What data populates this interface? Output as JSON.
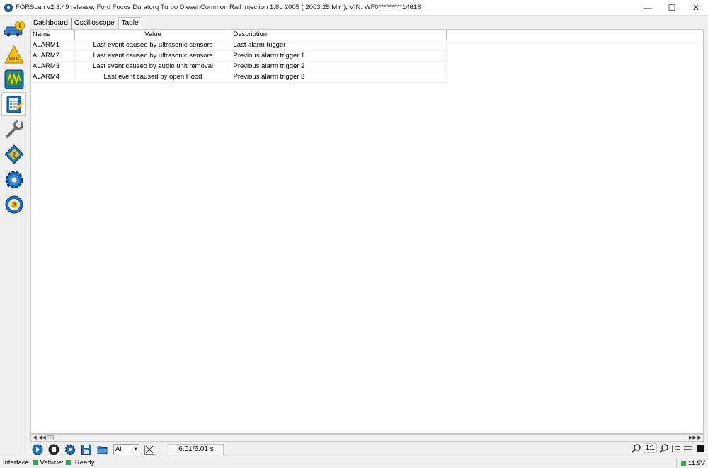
{
  "window": {
    "title": "FORScan v2.3.49 release, Ford Focus Duratorq Turbo Diesel Common Rail Injection 1.8L 2005 ( 2003.25 MY ), VIN: WF0*********14618",
    "minimize": "—",
    "maximize": "☐",
    "close": "✕"
  },
  "sidebar": {
    "items": [
      {
        "icon": "vehicle-info-icon"
      },
      {
        "icon": "dtc-icon"
      },
      {
        "icon": "oscilloscope-icon"
      },
      {
        "icon": "tests-checklist-icon"
      },
      {
        "icon": "service-wrench-icon"
      },
      {
        "icon": "configuration-chip-icon"
      },
      {
        "icon": "settings-gear-icon"
      },
      {
        "icon": "help-steering-icon"
      }
    ]
  },
  "tabs": [
    {
      "label": "Dashboard"
    },
    {
      "label": "Oscilloscope"
    },
    {
      "label": "Table"
    }
  ],
  "table": {
    "headers": {
      "name": "Name",
      "value": "Value",
      "description": "Description"
    },
    "rows": [
      {
        "name": "ALARM1",
        "value": "Last event caused by ultrasonic sensors",
        "description": "Last alarm trigger"
      },
      {
        "name": "ALARM2",
        "value": "Last event caused by ultrasonic sensors",
        "description": "Previous alarm trigger 1"
      },
      {
        "name": "ALARM3",
        "value": "Last event caused by audio unit removal",
        "description": "Previous alarm trigger 2"
      },
      {
        "name": "ALARM4",
        "value": "Last event caused by open Hood",
        "description": "Previous alarm trigger 3"
      }
    ]
  },
  "toolbar": {
    "filter_selected": "All",
    "time_display": "6.01/6.01 s",
    "zoom_ratio": "1:1"
  },
  "statusbar": {
    "interface_label": "Interface:",
    "vehicle_label": "Vehicle:",
    "status_text": "Ready",
    "voltage": "11.9V"
  },
  "colors": {
    "accent_blue": "#1a66c2",
    "status_green": "#2eaa45",
    "dtc_yellow": "#f2c200"
  }
}
